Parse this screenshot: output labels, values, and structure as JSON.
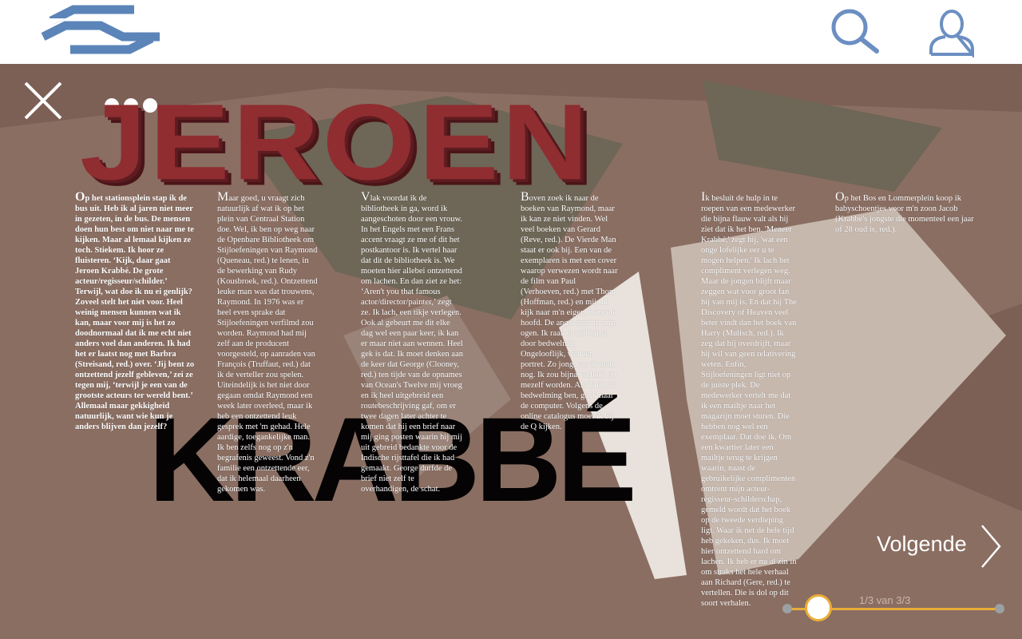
{
  "header": {
    "logo_name": "ns-logo",
    "search_icon": "search-icon",
    "user_icon": "user-icon",
    "colors": {
      "logo": "#5b84b8",
      "icons": "#6c8fc2",
      "background": "#ffffff"
    }
  },
  "viewer": {
    "close_icon": "close-icon",
    "more_icon": "more-icon",
    "background_color": "#7c5f55"
  },
  "article": {
    "title": "JEROEN",
    "subtitle": "KRABBÉ",
    "title_color": "#8f2d31",
    "columns": [
      {
        "initial": "O",
        "text": "p het stationsplein stap ik de bus uit. Heb ik al jaren niet meer in gezeten, in de bus. De mensen doen hun best om niet naar me te kijken. Maar al lemaal kijken ze toch. Stiekem. Ik hoor ze fluisteren. ‘Kijk, daar gaat Jeroen Krabbé. De grote acteur/regisseur/schilder.’ Terwijl, wat doe ik nu ei genlijk? Zoveel stelt het niet voor. Heel weinig mensen kunnen wat ik kan, maar voor mij is het zo doodnormaal dat ik me echt niet anders voel dan anderen. Ik had het er laatst nog met Barbra (Streisand, red.) over. ‘Jij bent zo ontzettend jezelf gebleven,’ zei ze tegen mij, ‘terwijl je een van de grootste acteurs ter wereld bent.’ Allemaal maar gekkigheid natuurlijk, want wie kun je anders blijven dan jezelf?"
      },
      {
        "initial": "M",
        "text": "aar goed, u vraagt zich natuurlijk af wat ik op het plein van Centraal Station doe. Wel, ik ben op weg naar de Openbare Bibliotheek om Stijloefeningen van Raymond (Queneau, red.) te lenen, in de bewerking van Rudy (Kousbroek, red.). Ontzettend leuke man was dat trouwens, Raymond. In 1976 was er heel even sprake dat Stijloefeningen verfilmd zou worden. Raymond had mij zelf aan de producent voorgesteld, op aanraden van François (Truffaut, red.) dat ik de verteller zou spelen. Uiteindelijk is het niet door gegaan omdat Raymond een week later overleed, maar ik heb een ontzettend leuk gesprek met 'm gehad. Hele aardige, toegankelijke man. Ik ben zelfs nog op z'n begrafenis geweest. Vond z'n familie een ontzettende eer, dat ik helemaal daarheen gekomen was."
      },
      {
        "initial": "V",
        "text": "lak voordat ik de bibliotheek in ga, word ik aangeschoten door een vrouw. In het Engels met een Frans accent vraagt ze me of dit het postkantoor is. Ik vertel haar dat dit de bibliotheek is. We moeten hier allebei ontzettend om lachen. En dan ziet ze het: ‘Aren't you that famous actor/director/painter,’ zegt ze. Ik lach, een tikje verlegen. Ook al gebeurt me dit elke dag wel een paar keer, ik kan er maar niet aan wennen. Heel gek is dat. Ik moet denken aan de keer dat George (Clooney, red.) ten tijde van de opnames van Ocean's Twelve mij vroeg en ik heel uitgebreid een routebeschrijving gaf, om er twee dagen later achter te komen dat hij een brief naar mij ging posten waarin hij mij uit gebreid bedankte voor de Indische rijsttafel die ik had gemaakt. George durfde de brief niet zelf te overhandigen, de schat."
      },
      {
        "initial": "B",
        "text": "oven zoek ik naar de boeken van Raymond, maar ik kan ze niet vinden. Wel veel boeken van Gerard (Reve, red.). De Vierde Man staat er ook bij. Een van de exemplaren is met een cover waarop verwezen wordt naar de film van Paul (Verhoeven, red.) met Thom (Hoffman, red.) en mij. Ik kijk naar m'n eigen, bezwete hoofd. De angst staat in mijn ogen. Ik raak er zelf bijna door bedwelmd. Ongelooflijk, wat een portret. Zo jong was ik toen nog. Ik zou bijna verliefd op mezelf worden. Als ik uit de bedwelming ben, ga ik naar de computer. Volgens de online catalogus moet ik bij de Q kijken."
      },
      {
        "initial": "I",
        "text": "k besluit de hulp in te roepen van een medewerker die bijna flauw valt als hij ziet dat ik het ben. 'Meneer Krabbé,' zegt hij, 'wat een onge lofelijke eer u te mogen helpen.' Ik lach het compliment verlegen weg. Maar de jongen blijft maar zeggen wat voor groot fan hij van mij is. En dat hij The Discovery of Heaven veel beter vindt dan het boek van Harry (Mulisch, red.). Ik zeg dat hij overdrijft, maar hij wil van geen relativering weten. Enfin, Stijloefeningen ligt niet op de juiste plek. De medewerker vertelt me dat ik een mailtje naar het magazijn moet sturen. Die hebben nog wel een exemplaar. Dat doe ik. Om een kwartier later een mailtje terug te krijgen waarin, naast de gebruikelijke complimenten omtrent mijn acteur-regisseur-schilderschap, gemeld wordt dat het boek op de tweede verdieping ligt. Waar ik net de hele tijd heb gekeken, dus. Ik moet hier ontzettend hard om lachen. Ik heb er nu al zin in om straks het hele verhaal aan Richard (Gere, red.) te vertellen. Die is dol op dit soort verhalen."
      },
      {
        "initial": "O",
        "text": "p het Bos en Lommerplein koop ik babyschoentjes voor m'n zoon Jacob (Krabbé's jongste die momenteel een jaar of 28 oud is, red.)."
      }
    ]
  },
  "navigation": {
    "next_label": "Volgende",
    "next_icon": "chevron-right-icon",
    "page_indicator": "1/3 van 3/3",
    "progress": 0.13,
    "colors": {
      "track": "#e9ad38",
      "thumb": "#ffffff"
    }
  }
}
